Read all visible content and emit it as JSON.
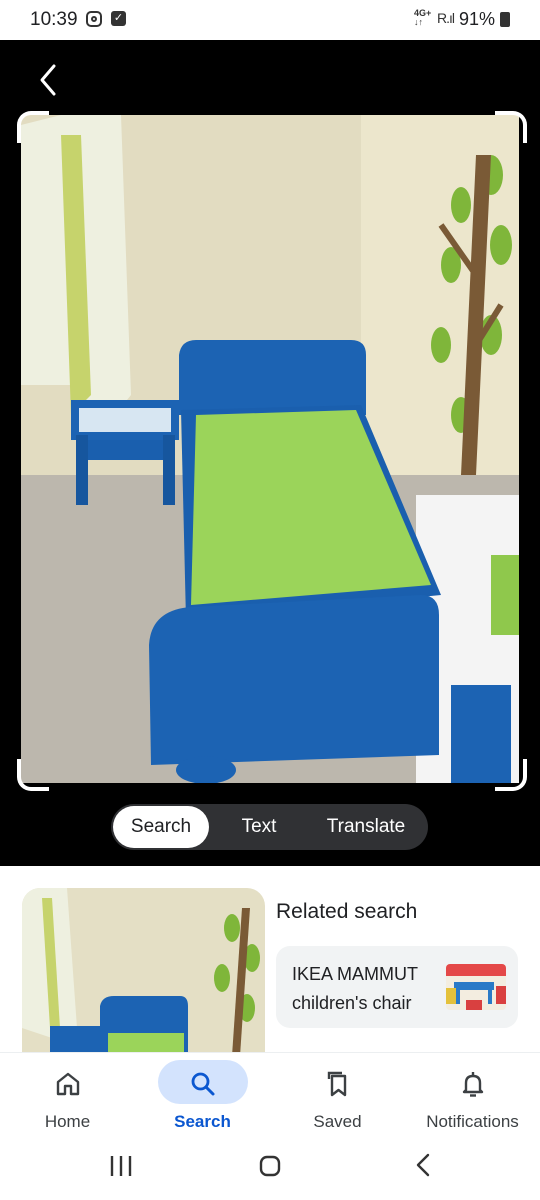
{
  "status_bar": {
    "time": "10:39",
    "network": "4G+",
    "battery": "91%"
  },
  "lens": {
    "modes": [
      {
        "label": "Search",
        "active": true
      },
      {
        "label": "Text",
        "active": false
      },
      {
        "label": "Translate",
        "active": false
      }
    ]
  },
  "results": {
    "related_title": "Related search",
    "chip_label": "IKEA MAMMUT children's chair"
  },
  "bottom_nav": {
    "items": [
      {
        "label": "Home",
        "icon": "home-icon"
      },
      {
        "label": "Search",
        "icon": "search-icon",
        "active": true
      },
      {
        "label": "Saved",
        "icon": "bookmarks-icon"
      },
      {
        "label": "Notifications",
        "icon": "bell-icon"
      }
    ]
  },
  "colors": {
    "accent": "#0b57d0",
    "active_pill": "#d3e3fd",
    "bed_blue": "#1c63b3",
    "sheet_green": "#9bd45a"
  }
}
